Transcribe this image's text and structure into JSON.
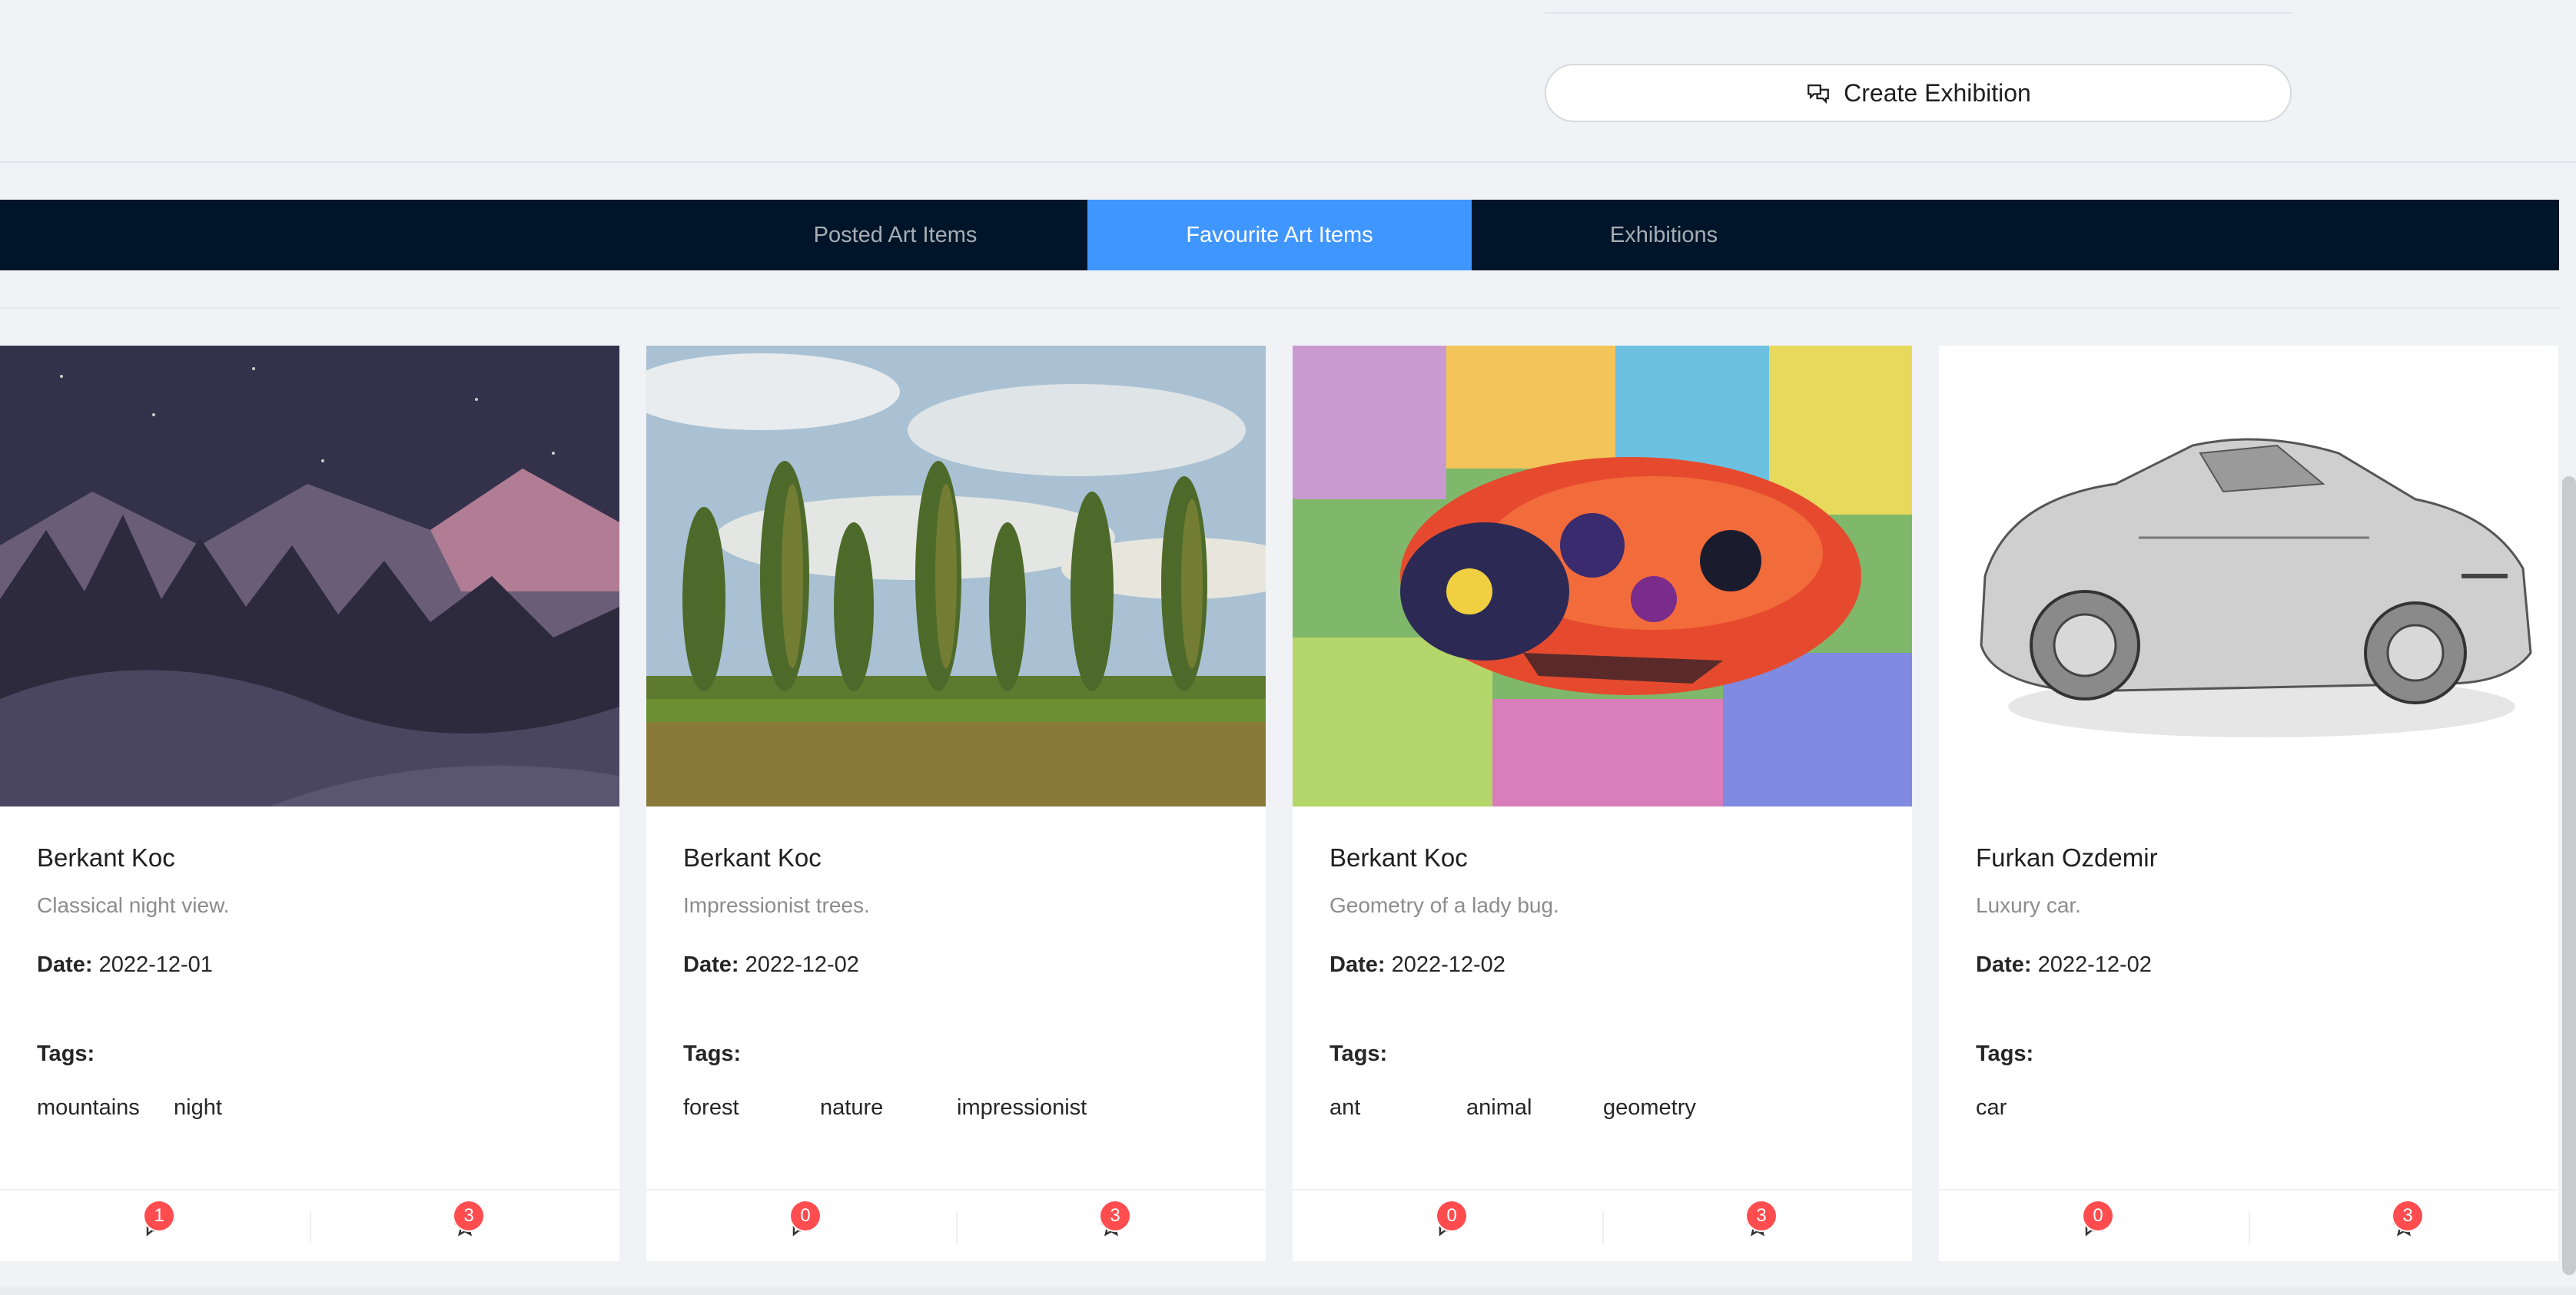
{
  "header": {
    "create_label": "Create Exhibition",
    "create_icon": "chat-bubbles-icon"
  },
  "tabs": [
    {
      "label": "Posted Art Items",
      "active": false
    },
    {
      "label": "Favourite Art Items",
      "active": true
    },
    {
      "label": "Exhibitions",
      "active": false
    }
  ],
  "cards": [
    {
      "artist": "Berkant Koc",
      "description": "Classical night view.",
      "date_label": "Date:",
      "date": "2022-12-01",
      "tags_label": "Tags:",
      "tags": [
        "mountains",
        "night"
      ],
      "comments": "1",
      "likes": "3"
    },
    {
      "artist": "Berkant Koc",
      "description": "Impressionist trees.",
      "date_label": "Date:",
      "date": "2022-12-02",
      "tags_label": "Tags:",
      "tags": [
        "forest",
        "nature",
        "impressionist"
      ],
      "comments": "0",
      "likes": "3"
    },
    {
      "artist": "Berkant Koc",
      "description": "Geometry of a lady bug.",
      "date_label": "Date:",
      "date": "2022-12-02",
      "tags_label": "Tags:",
      "tags": [
        "ant",
        "animal",
        "geometry"
      ],
      "comments": "0",
      "likes": "3"
    },
    {
      "artist": "Furkan Ozdemir",
      "description": "Luxury car.",
      "date_label": "Date:",
      "date": "2022-12-02",
      "tags_label": "Tags:",
      "tags": [
        "car"
      ],
      "comments": "0",
      "likes": "3"
    }
  ],
  "colors": {
    "tabbar": "#001529",
    "active_tab": "#4096ff",
    "badge": "#ff4d4f"
  }
}
